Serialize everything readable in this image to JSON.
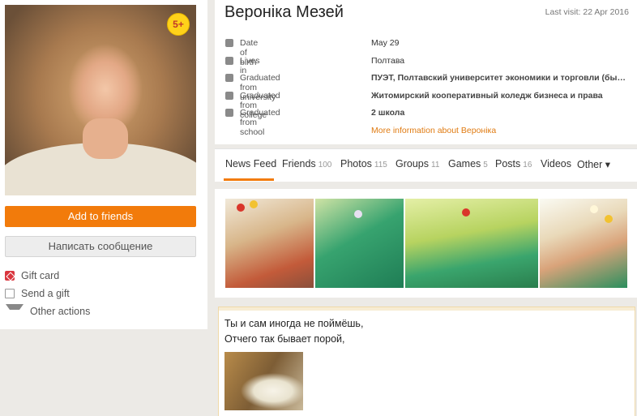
{
  "profile": {
    "name": "Вероніка Мезей",
    "last_visit": "Last visit: 22 Apr 2016",
    "age_badge": "5+",
    "add_to_friends": "Add to friends",
    "write_message": "Написать сообщение",
    "actions": [
      {
        "label": "Gift card",
        "icon": "gift-card-icon"
      },
      {
        "label": "Send a gift",
        "icon": "gift-icon"
      },
      {
        "label": "Other actions",
        "icon": "caret-down-icon"
      }
    ],
    "info": [
      {
        "label": "Date of birth",
        "value": "May 29",
        "icon": "birthday-cake-icon"
      },
      {
        "label": "Lives in",
        "value": "Полтава",
        "icon": "house-icon"
      },
      {
        "label": "Graduated from university",
        "value": "ПУЭТ, Полтавский университет экономики и торговли (бывш. ПУ...",
        "icon": "graduation-cap-icon"
      },
      {
        "label": "Graduated from college",
        "value": "Житомирский кооперативный коледж бизнеса и права",
        "icon": "book-icon"
      },
      {
        "label": "Graduated from school",
        "value": "2 школа",
        "icon": "school-bell-icon"
      }
    ],
    "more_info": "More information about Вероніка"
  },
  "tabs": [
    {
      "label": "News Feed",
      "count": ""
    },
    {
      "label": "Friends",
      "count": "100"
    },
    {
      "label": "Photos",
      "count": "115"
    },
    {
      "label": "Groups",
      "count": "11"
    },
    {
      "label": "Games",
      "count": "5"
    },
    {
      "label": "Posts",
      "count": "16"
    },
    {
      "label": "Videos",
      "count": ""
    },
    {
      "label": "Other ▾",
      "count": ""
    }
  ],
  "post": {
    "line1": "Ты и сам иногда не поймёшь,",
    "line2": "Отчего так бывает порой,"
  },
  "colors": {
    "accent": "#f27b0b",
    "link": "#e07b12",
    "badge": "#ffd21a"
  }
}
